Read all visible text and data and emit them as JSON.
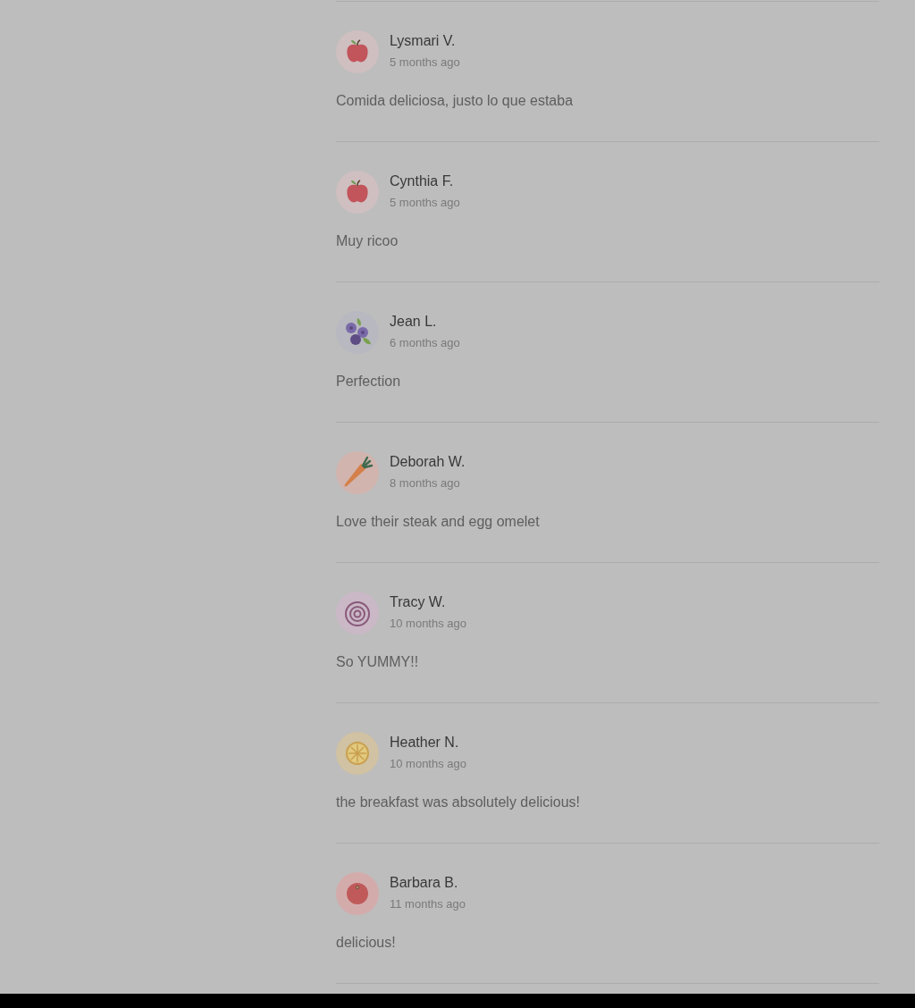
{
  "reviews": [
    {
      "kind": "apple",
      "name": "Lysmari V.",
      "time": "5 months ago",
      "comment": "Comida deliciosa, justo lo que estaba"
    },
    {
      "kind": "apple",
      "name": "Cynthia F.",
      "time": "5 months ago",
      "comment": "Muy ricoo"
    },
    {
      "kind": "blueberries",
      "name": "Jean L.",
      "time": "6 months ago",
      "comment": "Perfection"
    },
    {
      "kind": "carrot",
      "name": "Deborah W.",
      "time": "8 months ago",
      "comment": "Love their steak and egg omelet"
    },
    {
      "kind": "onion",
      "name": "Tracy W.",
      "time": "10 months ago",
      "comment": "So YUMMY!!"
    },
    {
      "kind": "lemon",
      "name": "Heather N.",
      "time": "10 months ago",
      "comment": "the breakfast was absolutely delicious!"
    },
    {
      "kind": "tomato",
      "name": "Barbara B.",
      "time": "11 months ago",
      "comment": "delicious!"
    }
  ]
}
